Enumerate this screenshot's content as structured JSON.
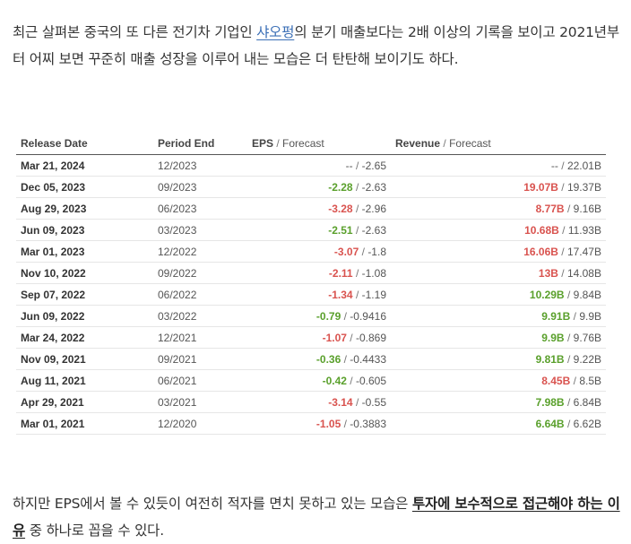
{
  "intro": {
    "line1_pre": "최근 살펴본 중국의 또 다른 전기차 기업인 ",
    "link": "샤오펑",
    "line1_post": "의 분기 매출보다는 2배 이상의 기록을 보이고 2021년부터 어찌 보면 꾸준히 매출 성장을 이루어 내는 모습은 더 탄탄해 보이기도 하다."
  },
  "table": {
    "headers": {
      "release_date": "Release Date",
      "period_end": "Period End",
      "eps": "EPS",
      "revenue": "Revenue",
      "forecast": "Forecast",
      "separator": "/"
    },
    "rows": [
      {
        "release": "Mar 21, 2024",
        "period": "12/2023",
        "eps": "--",
        "eps_trend": "neutral",
        "eps_forecast": "-2.65",
        "revenue": "--",
        "rev_trend": "neutral",
        "rev_forecast": "22.01B"
      },
      {
        "release": "Dec 05, 2023",
        "period": "09/2023",
        "eps": "-2.28",
        "eps_trend": "positive",
        "eps_forecast": "-2.63",
        "revenue": "19.07B",
        "rev_trend": "negative",
        "rev_forecast": "19.37B"
      },
      {
        "release": "Aug 29, 2023",
        "period": "06/2023",
        "eps": "-3.28",
        "eps_trend": "negative",
        "eps_forecast": "-2.96",
        "revenue": "8.77B",
        "rev_trend": "negative",
        "rev_forecast": "9.16B"
      },
      {
        "release": "Jun 09, 2023",
        "period": "03/2023",
        "eps": "-2.51",
        "eps_trend": "positive",
        "eps_forecast": "-2.63",
        "revenue": "10.68B",
        "rev_trend": "negative",
        "rev_forecast": "11.93B"
      },
      {
        "release": "Mar 01, 2023",
        "period": "12/2022",
        "eps": "-3.07",
        "eps_trend": "negative",
        "eps_forecast": "-1.8",
        "revenue": "16.06B",
        "rev_trend": "negative",
        "rev_forecast": "17.47B"
      },
      {
        "release": "Nov 10, 2022",
        "period": "09/2022",
        "eps": "-2.11",
        "eps_trend": "negative",
        "eps_forecast": "-1.08",
        "revenue": "13B",
        "rev_trend": "negative",
        "rev_forecast": "14.08B"
      },
      {
        "release": "Sep 07, 2022",
        "period": "06/2022",
        "eps": "-1.34",
        "eps_trend": "negative",
        "eps_forecast": "-1.19",
        "revenue": "10.29B",
        "rev_trend": "positive",
        "rev_forecast": "9.84B"
      },
      {
        "release": "Jun 09, 2022",
        "period": "03/2022",
        "eps": "-0.79",
        "eps_trend": "positive",
        "eps_forecast": "-0.9416",
        "revenue": "9.91B",
        "rev_trend": "positive",
        "rev_forecast": "9.9B"
      },
      {
        "release": "Mar 24, 2022",
        "period": "12/2021",
        "eps": "-1.07",
        "eps_trend": "negative",
        "eps_forecast": "-0.869",
        "revenue": "9.9B",
        "rev_trend": "positive",
        "rev_forecast": "9.76B"
      },
      {
        "release": "Nov 09, 2021",
        "period": "09/2021",
        "eps": "-0.36",
        "eps_trend": "positive",
        "eps_forecast": "-0.4433",
        "revenue": "9.81B",
        "rev_trend": "positive",
        "rev_forecast": "9.22B"
      },
      {
        "release": "Aug 11, 2021",
        "period": "06/2021",
        "eps": "-0.42",
        "eps_trend": "positive",
        "eps_forecast": "-0.605",
        "revenue": "8.45B",
        "rev_trend": "negative",
        "rev_forecast": "8.5B"
      },
      {
        "release": "Apr 29, 2021",
        "period": "03/2021",
        "eps": "-3.14",
        "eps_trend": "negative",
        "eps_forecast": "-0.55",
        "revenue": "7.98B",
        "rev_trend": "positive",
        "rev_forecast": "6.84B"
      },
      {
        "release": "Mar 01, 2021",
        "period": "12/2020",
        "eps": "-1.05",
        "eps_trend": "negative",
        "eps_forecast": "-0.3883",
        "revenue": "6.64B",
        "rev_trend": "positive",
        "rev_forecast": "6.62B"
      }
    ]
  },
  "outro": {
    "pre": "하지만 EPS에서 볼 수 있듯이 여전히 적자를 면치 못하고 있는 모습은 ",
    "emphasis": "투자에 보수적으로 접근해야 하는 이유",
    "post": " 중 하나로 꼽을 수 있다."
  },
  "colors": {
    "positive": "#5aa02c",
    "negative": "#d9534f",
    "link": "#3b6fb6"
  }
}
